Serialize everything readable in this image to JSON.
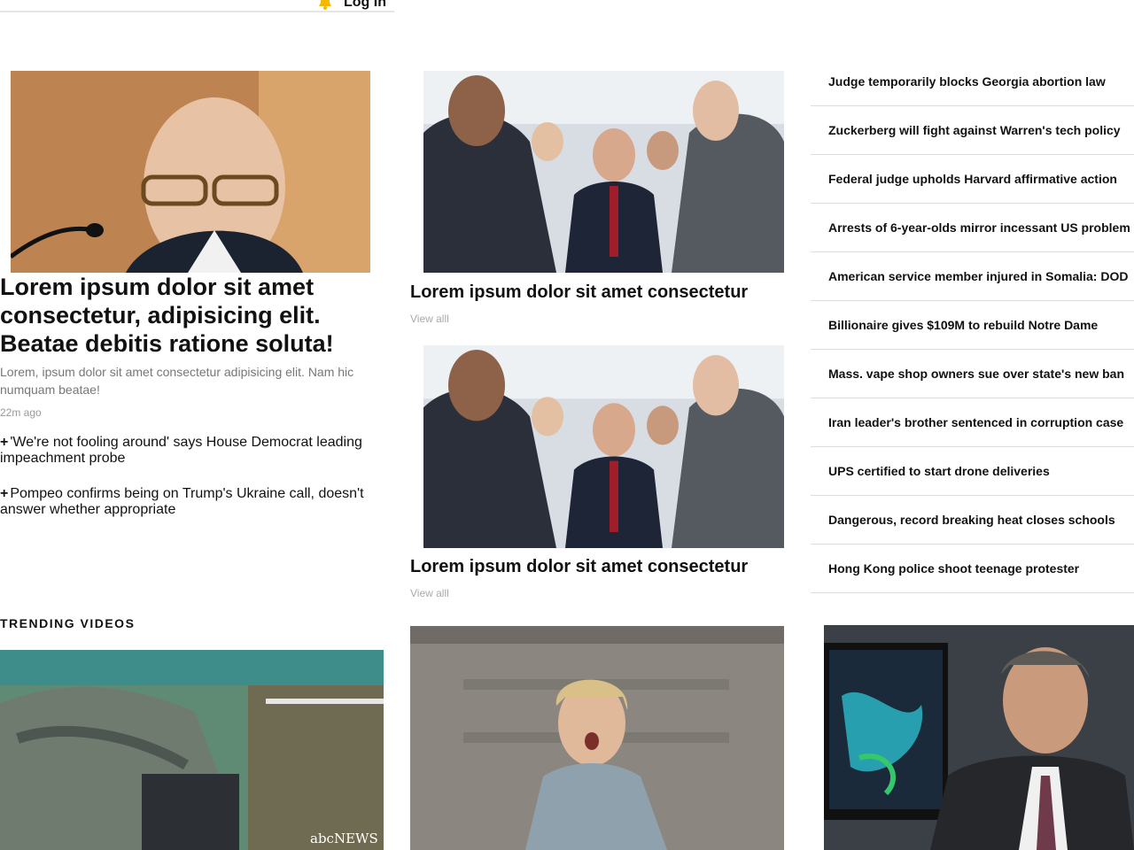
{
  "header": {
    "login_label": "Log In",
    "bell_icon": "bell-icon",
    "accent": "#f5b700"
  },
  "lead": {
    "title": "Lorem ipsum dolor sit amet consectetur, adipisicing elit. Beatae debitis ratione soluta!",
    "description": "Lorem, ipsum dolor sit amet consectetur adipisicing elit. Nam hic numquam beatae!",
    "time": "22m ago",
    "related": [
      {
        "marker": "+",
        "text": "'We're not fooling around' says House Democrat leading impeachment probe"
      },
      {
        "marker": "+",
        "text": "Pompeo confirms being on Trump's Ukraine call, doesn't answer whether appropriate"
      }
    ]
  },
  "middle": [
    {
      "title": "Lorem ipsum dolor sit amet consectetur",
      "link": "View alll"
    },
    {
      "title": "Lorem ipsum dolor sit amet consectetur",
      "link": "View alll"
    }
  ],
  "headlines": [
    "Judge temporarily blocks Georgia abortion law",
    "Zuckerberg will fight against Warren's tech policy",
    "Federal judge upholds Harvard affirmative action",
    "Arrests of 6-year-olds mirror incessant US problem",
    "American service member injured in Somalia: DOD",
    "Billionaire gives $109M to rebuild Notre Dame",
    "Mass. vape shop owners sue over state's new ban",
    "Iran leader's brother sentenced in corruption case",
    "UPS certified to start drone deliveries",
    "Dangerous, record breaking heat closes schools",
    "Hong Kong police shoot teenage protester"
  ],
  "trending": {
    "heading": "TRENDING VIDEOS",
    "video_badge": "abcNEWS"
  }
}
